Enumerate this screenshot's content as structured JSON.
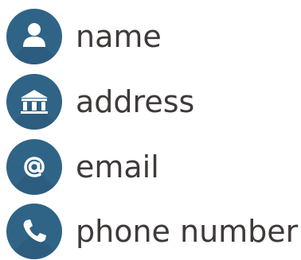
{
  "items": [
    {
      "icon": "person-icon",
      "label": "name"
    },
    {
      "icon": "building-icon",
      "label": "address"
    },
    {
      "icon": "at-sign-icon",
      "label": "email"
    },
    {
      "icon": "phone-icon",
      "label": "phone number"
    }
  ],
  "colors": {
    "circle": "#2f6487",
    "text": "#3f3a39",
    "glyph": "#ffffff"
  }
}
